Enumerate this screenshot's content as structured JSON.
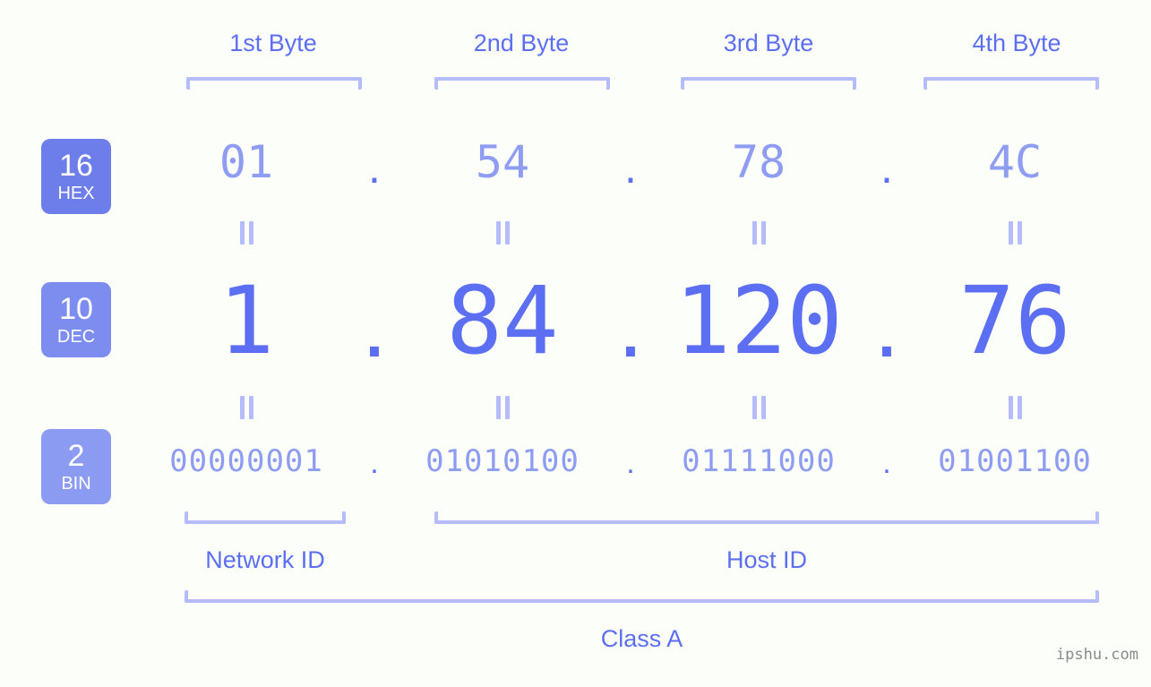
{
  "background_color": "#fcfefa",
  "accent_color": "#5c6ff2",
  "accent_light_color": "#8e9cf2",
  "bracket_color": "#b4bdfa",
  "byte_headers": [
    {
      "label": "1st Byte"
    },
    {
      "label": "2nd Byte"
    },
    {
      "label": "3rd Byte"
    },
    {
      "label": "4th Byte"
    }
  ],
  "bases": [
    {
      "key": "hex",
      "number": "16",
      "name": "HEX",
      "badge_color": "#6d7eea"
    },
    {
      "key": "dec",
      "number": "10",
      "name": "DEC",
      "badge_color": "#7d8cef"
    },
    {
      "key": "bin",
      "number": "2",
      "name": "BIN",
      "badge_color": "#8c9bf2"
    }
  ],
  "separator": ".",
  "rows": {
    "hex": {
      "octets": [
        "01",
        "54",
        "78",
        "4C"
      ]
    },
    "dec": {
      "octets": [
        "1",
        "84",
        "120",
        "76"
      ]
    },
    "bin": {
      "octets": [
        "00000001",
        "01010100",
        "01111000",
        "01001100"
      ]
    }
  },
  "address": {
    "dec_full": "1.84.120.76",
    "hex_full": "01.54.78.4C",
    "bin_full": "00000001.01010100.01111000.01001100"
  },
  "equals_sign": "=",
  "sections": [
    {
      "key": "network",
      "label": "Network ID"
    },
    {
      "key": "host",
      "label": "Host ID"
    }
  ],
  "class": {
    "label": "Class A"
  },
  "watermark": {
    "text": "ipshu.com"
  }
}
